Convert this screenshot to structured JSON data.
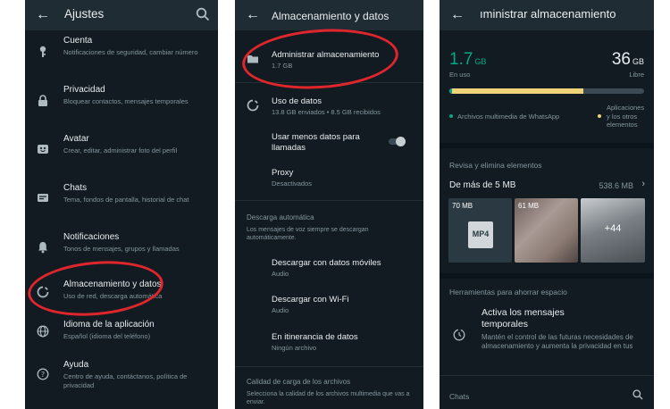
{
  "panel1": {
    "title": "Ajustes",
    "items": [
      {
        "title": "Cuenta",
        "subtitle": "Notificaciones de seguridad, cambiar número"
      },
      {
        "title": "Privacidad",
        "subtitle": "Bloquear contactos, mensajes temporales"
      },
      {
        "title": "Avatar",
        "subtitle": "Crear, editar, administrar foto del perfil"
      },
      {
        "title": "Chats",
        "subtitle": "Tema, fondos de pantalla, historial de chat"
      },
      {
        "title": "Notificaciones",
        "subtitle": "Tonos de mensajes, grupos y llamadas"
      },
      {
        "title": "Almacenamiento y datos",
        "subtitle": "Uso de red, descarga automática"
      },
      {
        "title": "Idioma de la aplicación",
        "subtitle": "Español (idioma del teléfono)"
      },
      {
        "title": "Ayuda",
        "subtitle": "Centro de ayuda, contáctanos, política de privacidad"
      }
    ]
  },
  "panel2": {
    "title": "Almacenamiento y datos",
    "manage": {
      "title": "Administrar almacenamiento",
      "subtitle": "1.7 GB"
    },
    "usage": {
      "title": "Uso de datos",
      "subtitle": "13.8 GB enviados • 8.5 GB recibidos"
    },
    "less_data": {
      "title": "Usar menos datos para llamadas"
    },
    "proxy": {
      "title": "Proxy",
      "subtitle": "Desactivados"
    },
    "auto_header": "Descarga automática",
    "auto_desc": "Los mensajes de voz siempre se descargan automáticamente.",
    "mobile": {
      "title": "Descargar con datos móviles",
      "subtitle": "Audio"
    },
    "wifi": {
      "title": "Descargar con Wi-Fi",
      "subtitle": "Audio"
    },
    "roaming": {
      "title": "En itinerancia de datos",
      "subtitle": "Ningún archivo"
    },
    "quality_header": "Calidad de carga de los archivos",
    "quality_desc": "Selecciona la calidad de los archivos multimedia que vas a enviar."
  },
  "panel3": {
    "title": "ıministrar almacenamiento",
    "used_value": "1.7",
    "used_unit": "GB",
    "used_label": "En uso",
    "free_value": "36",
    "free_unit": "GB",
    "free_label": "Libre",
    "used_fraction": 0.045,
    "legend_whatsapp": "Archivos multimedia de WhatsApp",
    "legend_apps": "Aplicaciones y los otros elementos",
    "review_header": "Revisa y elimina elementos",
    "large_title": "De más de 5 MB",
    "large_size": "538.6 MB",
    "thumbs": [
      {
        "label": "70 MB",
        "type": "MP4"
      },
      {
        "label": "61 MB"
      },
      {
        "more": "+44"
      }
    ],
    "tools_header": "Herramientas para ahorrar espacio",
    "temp_title": "Activa los mensajes temporales",
    "temp_desc": "Mantén el control de las futuras necesidades de almacenamiento y aumenta la privacidad en tus",
    "chats_label": "Chats"
  },
  "colors": {
    "background": "#111b21",
    "header": "#1f2c34",
    "accent": "#00a884",
    "highlight": "#e0262d",
    "apps_bar": "#f0d278"
  }
}
